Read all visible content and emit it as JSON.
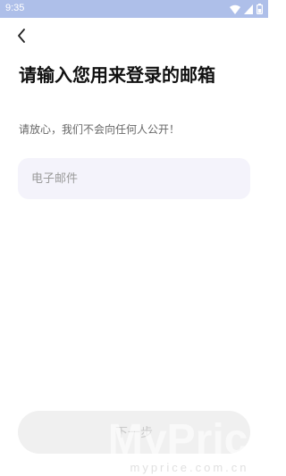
{
  "status_bar": {
    "time": "9:35",
    "icons": [
      "wifi-icon",
      "signal-icon",
      "battery-icon"
    ],
    "background": "#aebfe9"
  },
  "header": {
    "back_icon": "chevron-left-icon"
  },
  "main": {
    "title": "请输入您用来登录的邮箱",
    "subtitle": "请放心，我们不会向任何人公开！"
  },
  "email": {
    "placeholder": "电子邮件",
    "value": ""
  },
  "footer": {
    "next_label": "下一步"
  },
  "watermark": {
    "brand": "MyPrice",
    "url": "myprice.com.cn"
  },
  "colors": {
    "input_bg": "#f4f3fb",
    "button_bg": "#f0f0f0",
    "title": "#111111"
  }
}
